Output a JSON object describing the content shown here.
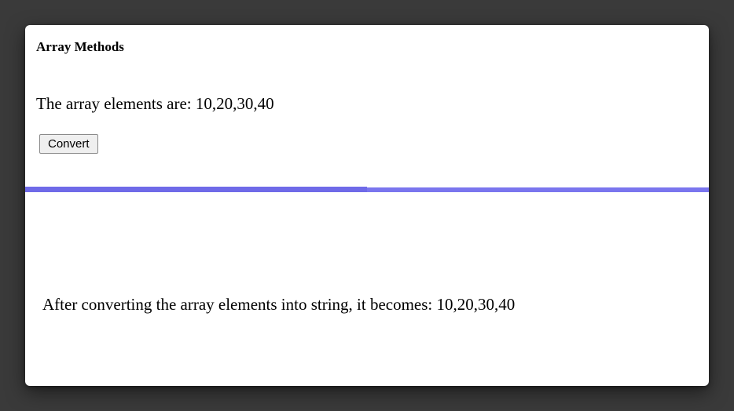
{
  "heading": "Array Methods",
  "arrayLine": "The array elements are: 10,20,30,40",
  "buttonLabel": "Convert",
  "resultLine": "After converting the array elements into string, it becomes: 10,20,30,40"
}
